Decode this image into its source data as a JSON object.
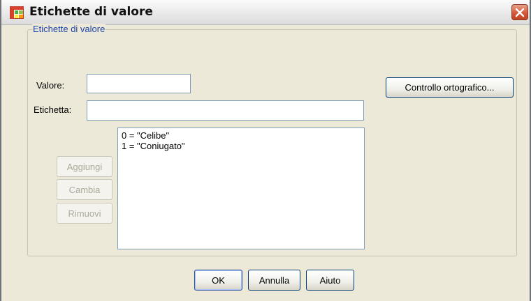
{
  "window": {
    "title": "Etichette di valore",
    "close_symbol": "×",
    "icon": "grid-table-icon"
  },
  "group": {
    "legend": "Etichette di valore"
  },
  "fields": {
    "valore_label": "Valore:",
    "valore_value": "",
    "etichetta_label": "Etichetta:",
    "etichetta_value": ""
  },
  "buttons": {
    "spell_check": "Controllo ortografico...",
    "add": "Aggiungi",
    "change": "Cambia",
    "remove": "Rimuovi",
    "ok": "OK",
    "cancel": "Annulla",
    "help": "Aiuto"
  },
  "list": {
    "items": [
      "0 = \"Celibe\"",
      "1 = \"Coniugato\""
    ]
  }
}
